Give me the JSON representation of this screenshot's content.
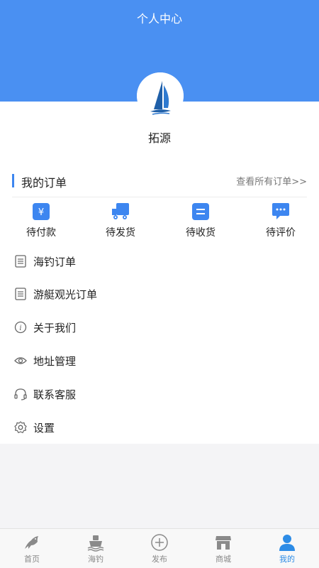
{
  "header": {
    "title": "个人中心"
  },
  "profile": {
    "name": "拓源"
  },
  "orders": {
    "title": "我的订单",
    "view_all": "查看所有订单>>",
    "items": [
      {
        "label": "待付款",
        "icon": "yen-icon"
      },
      {
        "label": "待发货",
        "icon": "truck-icon"
      },
      {
        "label": "待收货",
        "icon": "receive-icon"
      },
      {
        "label": "待评价",
        "icon": "comment-icon"
      }
    ]
  },
  "menu": {
    "items": [
      {
        "label": "海钓订单",
        "icon": "list-icon"
      },
      {
        "label": "游艇观光订单",
        "icon": "list-icon"
      },
      {
        "label": "关于我们",
        "icon": "info-icon"
      },
      {
        "label": "地址管理",
        "icon": "location-icon"
      },
      {
        "label": "联系客服",
        "icon": "headset-icon"
      },
      {
        "label": "设置",
        "icon": "gear-icon"
      }
    ]
  },
  "tabbar": {
    "items": [
      {
        "label": "首页",
        "icon": "fish-icon"
      },
      {
        "label": "海钓",
        "icon": "boat-icon"
      },
      {
        "label": "发布",
        "icon": "plus-circle-icon"
      },
      {
        "label": "商城",
        "icon": "store-icon"
      },
      {
        "label": "我的",
        "icon": "user-icon",
        "active": true
      }
    ]
  },
  "colors": {
    "header_bg": "#4a90f2",
    "accent": "#3d86f0",
    "tab_active": "#2d8ce6"
  }
}
